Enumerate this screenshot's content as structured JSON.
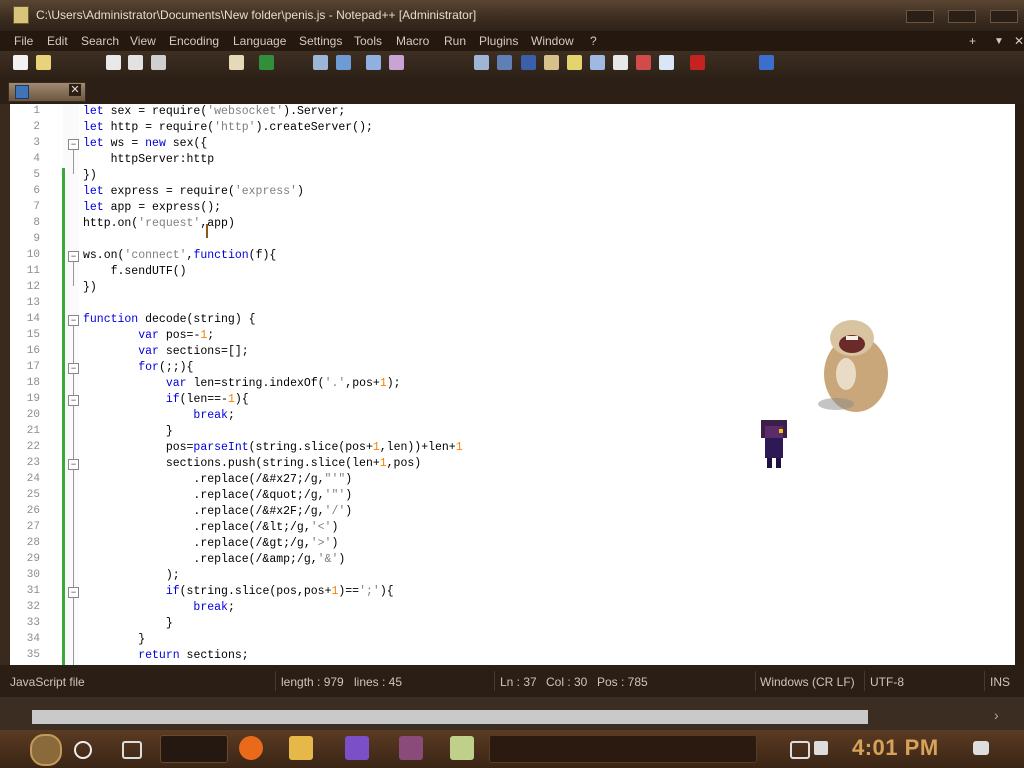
{
  "window": {
    "title": "C:\\Users\\Administrator\\Documents\\New folder\\penis.js - Notepad++ [Administrator]"
  },
  "menu": {
    "items": [
      "File",
      "Edit",
      "Search",
      "View",
      "Encoding",
      "Language",
      "Settings",
      "Tools",
      "Macro",
      "Run",
      "Plugins",
      "Window",
      "?"
    ],
    "right_icons": [
      "+",
      "▼",
      "✕"
    ]
  },
  "tab": {
    "close_glyph": "✕"
  },
  "editor": {
    "lines": [
      {
        "n": "1",
        "html": "<span class='kw'>let</span> sex = require(<span class='str'>'websocket'</span>).Server;"
      },
      {
        "n": "2",
        "html": "<span class='kw'>let</span> http = require(<span class='str'>'http'</span>).createServer();"
      },
      {
        "n": "3",
        "html": "<span class='kw'>let</span> ws = <span class='kw'>new</span> sex({"
      },
      {
        "n": "4",
        "html": "    httpServer:http"
      },
      {
        "n": "5",
        "html": "})"
      },
      {
        "n": "6",
        "html": "<span class='kw'>let</span> express = require(<span class='str'>'express'</span>)"
      },
      {
        "n": "7",
        "html": "<span class='kw'>let</span> app = express();"
      },
      {
        "n": "8",
        "html": "http.on(<span class='str'>'request'</span>,app)"
      },
      {
        "n": "9",
        "html": ""
      },
      {
        "n": "10",
        "html": "ws.on(<span class='str'>'connect'</span>,<span class='kw'>function</span>(f){"
      },
      {
        "n": "11",
        "html": "    f.sendUTF()"
      },
      {
        "n": "12",
        "html": "})"
      },
      {
        "n": "13",
        "html": ""
      },
      {
        "n": "14",
        "html": "<span class='kw'>function</span> decode(string) {"
      },
      {
        "n": "15",
        "html": "        <span class='kw'>var</span> pos=-<span class='num'>1</span>;"
      },
      {
        "n": "16",
        "html": "        <span class='kw'>var</span> sections=[];"
      },
      {
        "n": "17",
        "html": "        <span class='kw'>for</span>(;;){"
      },
      {
        "n": "18",
        "html": "            <span class='kw'>var</span> len=string.indexOf(<span class='str'>'.'</span>,pos+<span class='num'>1</span>);"
      },
      {
        "n": "19",
        "html": "            <span class='kw'>if</span>(len==-<span class='num'>1</span>){"
      },
      {
        "n": "20",
        "html": "                <span class='kw'>break</span>;"
      },
      {
        "n": "21",
        "html": "            }"
      },
      {
        "n": "22",
        "html": "            pos=<span class='kw'>parseInt</span>(string.slice(pos+<span class='num'>1</span>,len))+len+<span class='num'>1</span>"
      },
      {
        "n": "23",
        "html": "            sections.push(string.slice(len+<span class='num'>1</span>,pos)"
      },
      {
        "n": "24",
        "html": "                .replace(/&amp;#x27;/g,<span class='str'>\"'\"</span>)"
      },
      {
        "n": "25",
        "html": "                .replace(/&amp;quot;/g,<span class='str'>'\"'</span>)"
      },
      {
        "n": "26",
        "html": "                .replace(/&amp;#x2F;/g,<span class='str'>'/'</span>)"
      },
      {
        "n": "27",
        "html": "                .replace(/&amp;lt;/g,<span class='str'>'&lt;'</span>)"
      },
      {
        "n": "28",
        "html": "                .replace(/&amp;gt;/g,<span class='str'>'&gt;'</span>)"
      },
      {
        "n": "29",
        "html": "                .replace(/&amp;amp;/g,<span class='str'>'&amp;'</span>)"
      },
      {
        "n": "30",
        "html": "            );"
      },
      {
        "n": "31",
        "html": "            <span class='kw'>if</span>(string.slice(pos,pos+<span class='num'>1</span>)==<span class='str'>';'</span>){"
      },
      {
        "n": "32",
        "html": "                <span class='kw'>break</span>;"
      },
      {
        "n": "33",
        "html": "            }"
      },
      {
        "n": "34",
        "html": "        }"
      },
      {
        "n": "35",
        "html": "        <span class='kw'>return</span> sections;"
      }
    ]
  },
  "status": {
    "filetype": "JavaScript file",
    "length": "length : 979",
    "lines": "lines : 45",
    "ln": "Ln : 37",
    "col": "Col : 30",
    "pos": "Pos : 785",
    "eol": "Windows (CR LF)",
    "encoding": "UTF-8",
    "mode": "INS"
  },
  "taskbar": {
    "time": "4:01 PM"
  },
  "colors": {
    "keyword": "#0000e0",
    "string": "#808080",
    "number": "#ff8000",
    "change_bar": "#3aa83a",
    "clock": "#d9a25a"
  }
}
